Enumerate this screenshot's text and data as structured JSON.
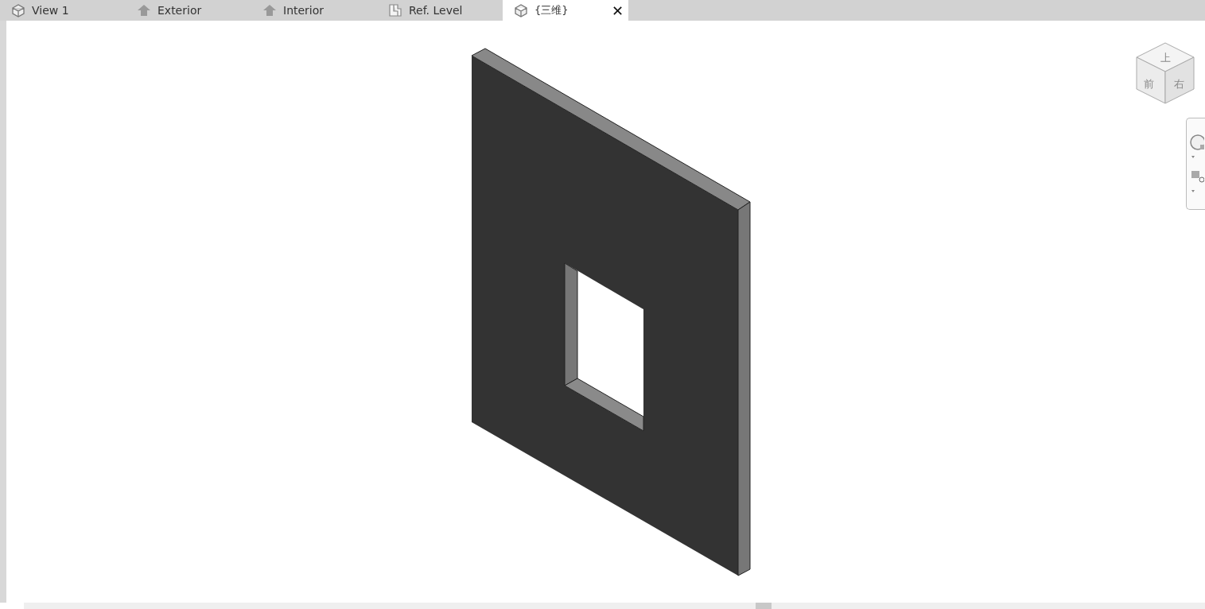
{
  "tabs": [
    {
      "label": "View 1",
      "kind": "model",
      "selected": false
    },
    {
      "label": "Exterior",
      "kind": "elevation",
      "selected": false
    },
    {
      "label": "Interior",
      "kind": "elevation",
      "selected": false
    },
    {
      "label": "Ref. Level",
      "kind": "plan",
      "selected": false
    },
    {
      "label": "{三维}",
      "kind": "model",
      "selected": true,
      "close": "✕"
    }
  ],
  "view_cube": {
    "top": "上",
    "front": "前",
    "right": "右"
  }
}
